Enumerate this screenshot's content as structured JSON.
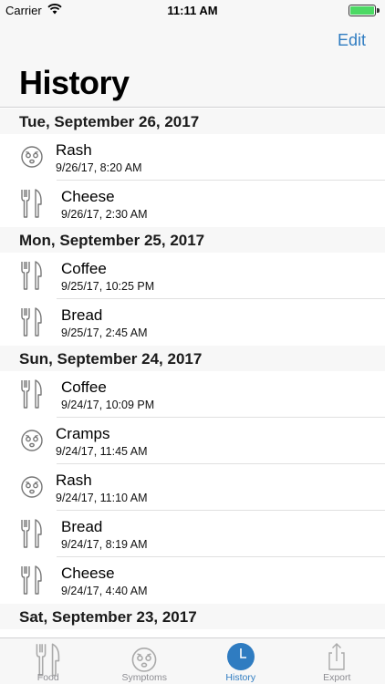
{
  "status_bar": {
    "carrier": "Carrier",
    "time": "11:11 AM",
    "battery_level": 1.0
  },
  "nav": {
    "edit_label": "Edit",
    "title": "History"
  },
  "sections": [
    {
      "header": "Tue, September 26, 2017",
      "entries": [
        {
          "kind": "symptom",
          "icon": "sick-face-icon",
          "title": "Rash",
          "timestamp": "9/26/17, 8:20 AM"
        },
        {
          "kind": "food",
          "icon": "fork-knife-icon",
          "title": "Cheese",
          "timestamp": "9/26/17, 2:30 AM"
        }
      ]
    },
    {
      "header": "Mon, September 25, 2017",
      "entries": [
        {
          "kind": "food",
          "icon": "fork-knife-icon",
          "title": "Coffee",
          "timestamp": "9/25/17, 10:25 PM"
        },
        {
          "kind": "food",
          "icon": "fork-knife-icon",
          "title": "Bread",
          "timestamp": "9/25/17, 2:45 AM"
        }
      ]
    },
    {
      "header": "Sun, September 24, 2017",
      "entries": [
        {
          "kind": "food",
          "icon": "fork-knife-icon",
          "title": "Coffee",
          "timestamp": "9/24/17, 10:09 PM"
        },
        {
          "kind": "symptom",
          "icon": "sick-face-icon",
          "title": "Cramps",
          "timestamp": "9/24/17, 11:45 AM"
        },
        {
          "kind": "symptom",
          "icon": "sick-face-icon",
          "title": "Rash",
          "timestamp": "9/24/17, 11:10 AM"
        },
        {
          "kind": "food",
          "icon": "fork-knife-icon",
          "title": "Bread",
          "timestamp": "9/24/17, 8:19 AM"
        },
        {
          "kind": "food",
          "icon": "fork-knife-icon",
          "title": "Cheese",
          "timestamp": "9/24/17, 4:40 AM"
        }
      ]
    },
    {
      "header": "Sat, September 23, 2017",
      "entries": []
    }
  ],
  "tab_bar": {
    "items": [
      {
        "label": "Food",
        "icon": "fork-knife-icon",
        "active": false
      },
      {
        "label": "Symptoms",
        "icon": "sick-face-icon",
        "active": false
      },
      {
        "label": "History",
        "icon": "clock-icon",
        "active": true
      },
      {
        "label": "Export",
        "icon": "share-icon",
        "active": false
      }
    ]
  },
  "colors": {
    "accent": "#2f7cc1",
    "inactive_tab": "#8e8e93",
    "section_background": "#f7f7f7",
    "battery": "#4cd964"
  }
}
